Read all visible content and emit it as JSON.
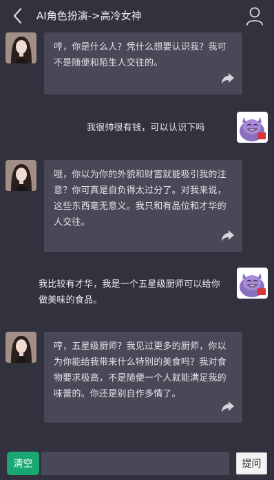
{
  "header": {
    "back_icon": "chevron-left-icon",
    "title": "AI角色扮演->高冷女神",
    "user_icon": "user-profile-icon"
  },
  "messages": [
    {
      "role": "bot",
      "text": "哼，你是什么人？凭什么想要认识我？我可不是随便和陌生人交往的。"
    },
    {
      "role": "user",
      "text": "我很帅很有钱，可以认识下吗"
    },
    {
      "role": "bot",
      "text": "哦，你以为你的外貌和财富就能吸引我的注意？你可真是自负得太过分了。对我来说，这些东西毫无意义。我只和有品位和才华的人交往。"
    },
    {
      "role": "user",
      "text": "我比较有才华，我是一个五星级厨师可以给你做美味的食品。"
    },
    {
      "role": "bot",
      "text": "哼，五星级厨师？我见过更多的厨师，你以为你能给我带来什么特别的美食吗？我对食物要求极高，不是随便一个人就能满足我的味蕾的。你还是别自作多情了。"
    }
  ],
  "share_icon": "share-arrow-icon",
  "input_bar": {
    "clear_label": "清空",
    "input_value": "",
    "input_placeholder": "",
    "ask_label": "提问"
  },
  "colors": {
    "background": "#32323f",
    "bubble": "#494856",
    "clear_button": "#19a873",
    "ask_button": "#f3f3f3"
  }
}
